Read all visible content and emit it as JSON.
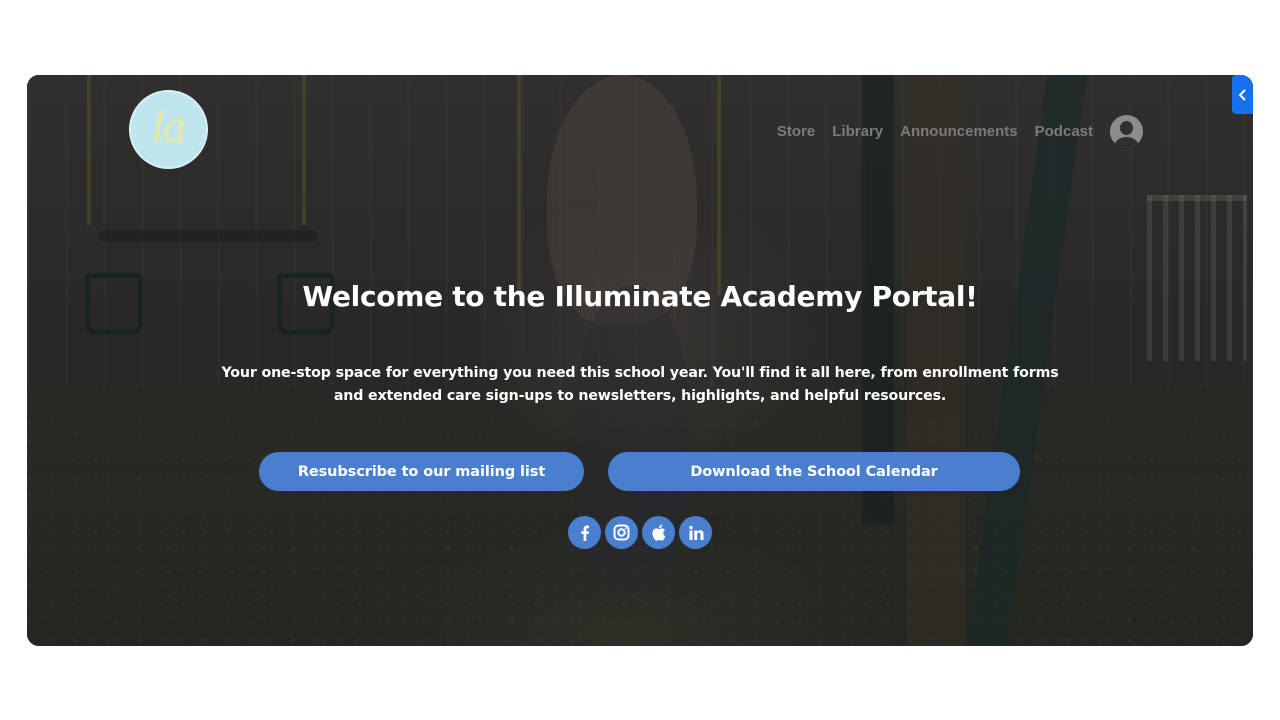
{
  "logo": {
    "text": "la"
  },
  "nav": {
    "items": [
      {
        "label": "Store"
      },
      {
        "label": "Library"
      },
      {
        "label": "Announcements"
      },
      {
        "label": "Podcast"
      }
    ]
  },
  "hero": {
    "title": "Welcome to the Illuminate Academy Portal!",
    "subtitle": "Your one-stop space for everything you need this school year. You'll find it all here, from enrollment forms and extended care sign-ups to newsletters, highlights, and helpful resources.",
    "buttons": {
      "resubscribe": "Resubscribe to our mailing list",
      "calendar": "Download the School Calendar"
    }
  },
  "socials": [
    {
      "icon": "facebook-icon"
    },
    {
      "icon": "instagram-icon"
    },
    {
      "icon": "apple-podcasts-icon"
    },
    {
      "icon": "linkedin-icon"
    }
  ],
  "colors": {
    "button": "#4a7fd0",
    "toggle_tab": "#1570ef",
    "logo_bg": "#bfe6ee",
    "logo_text": "#e8e99a",
    "nav_text": "#7b7b7b"
  }
}
